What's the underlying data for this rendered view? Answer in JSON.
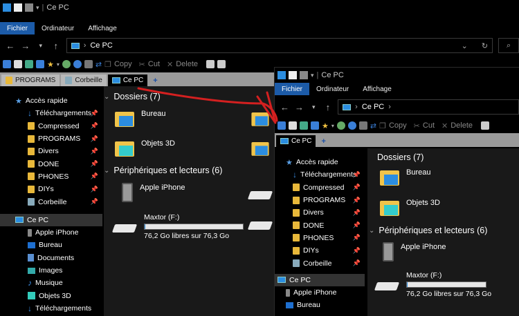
{
  "title": "Ce PC",
  "ribbon": {
    "file": "Fichier",
    "computer": "Ordinateur",
    "view": "Affichage"
  },
  "address": {
    "path": "Ce PC"
  },
  "toolbar": {
    "copy": "Copy",
    "cut": "Cut",
    "delete": "Delete"
  },
  "tabs": [
    "PROGRAMS",
    "Corbeille",
    "Ce PC"
  ],
  "tab_add": "+",
  "nav": {
    "quick_access": "Accès rapide",
    "quick_items": [
      "Téléchargements",
      "Compressed",
      "PROGRAMS",
      "Divers",
      "DONE",
      "PHONES",
      "DIYs",
      "Corbeille"
    ],
    "this_pc": "Ce PC",
    "pc_items": [
      "Apple iPhone",
      "Bureau",
      "Documents",
      "Images",
      "Musique",
      "Objets 3D",
      "Téléchargements"
    ]
  },
  "content": {
    "folders_header": "Dossiers (7)",
    "folders": [
      "Bureau",
      "Objets 3D"
    ],
    "devices_header": "Périphériques et lecteurs (6)",
    "device_phone": "Apple iPhone",
    "drive_name": "Maxtor (F:)",
    "drive_free": "76,2 Go libres sur 76,3 Go",
    "drive_used_fraction": 0.002
  },
  "colors": {
    "accent": "#1c5ba8",
    "annotation": "#d42020"
  }
}
